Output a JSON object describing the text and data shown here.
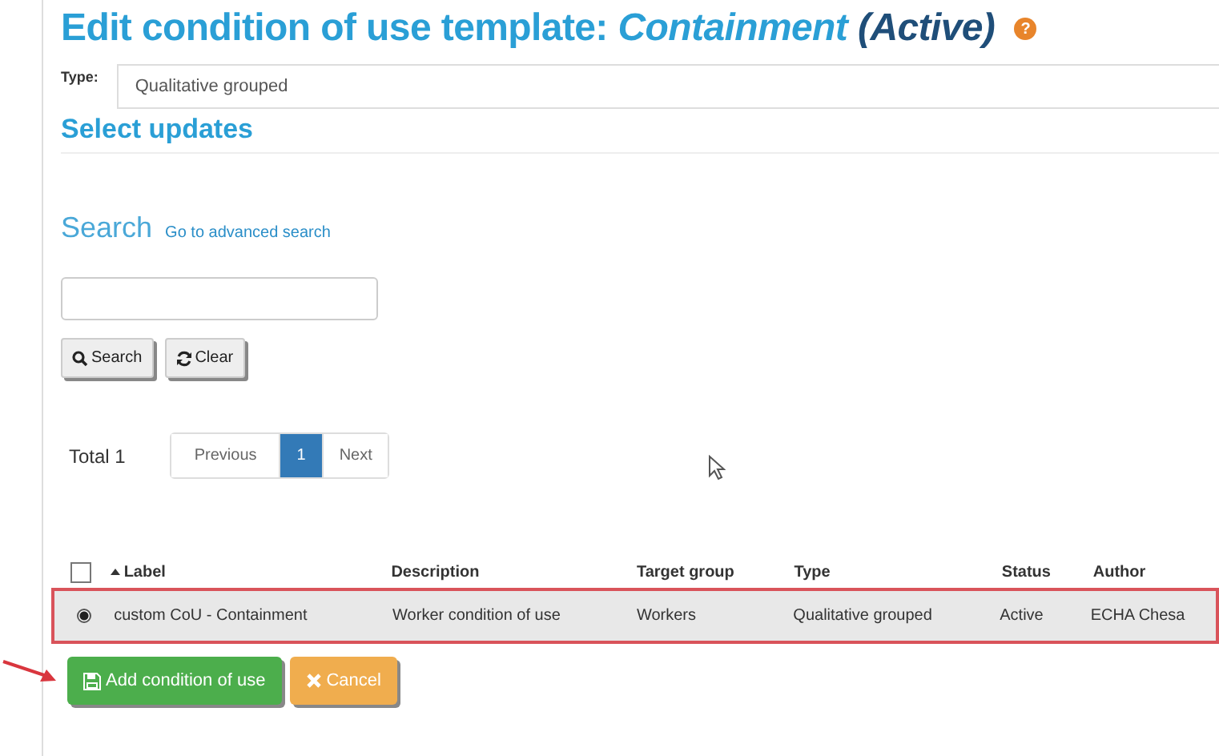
{
  "title": {
    "prefix": "Edit condition of use template: ",
    "name": "Containment",
    "status": "(Active)",
    "help": "?"
  },
  "type_field": {
    "label": "Type:",
    "value": "Qualitative grouped"
  },
  "select_heading": "Select updates",
  "search": {
    "heading": "Search",
    "advanced_link": "Go to advanced search",
    "search_button": "Search",
    "clear_button": "Clear"
  },
  "pagination": {
    "total": "Total 1",
    "previous": "Previous",
    "next": "Next",
    "pages": [
      {
        "label": "1",
        "selected": true
      }
    ]
  },
  "table": {
    "columns": [
      {
        "label": "Label",
        "sorted": true
      },
      {
        "label": "Description",
        "sorted": false
      },
      {
        "label": "Target group",
        "sorted": false
      },
      {
        "label": "Type",
        "sorted": false
      },
      {
        "label": "Status",
        "sorted": false
      },
      {
        "label": "Author",
        "sorted": false
      }
    ],
    "all_checked": false,
    "rows": [
      {
        "selected": true,
        "highlighted": true,
        "cells": [
          "custom CoU - Containment",
          "Worker condition of use",
          "Workers",
          "Qualitative grouped",
          "Active",
          "ECHA Chesa"
        ]
      }
    ]
  },
  "actions": [
    {
      "label": "Add condition of use",
      "kind": "save"
    },
    {
      "label": "Cancel",
      "kind": "cancel"
    }
  ]
}
